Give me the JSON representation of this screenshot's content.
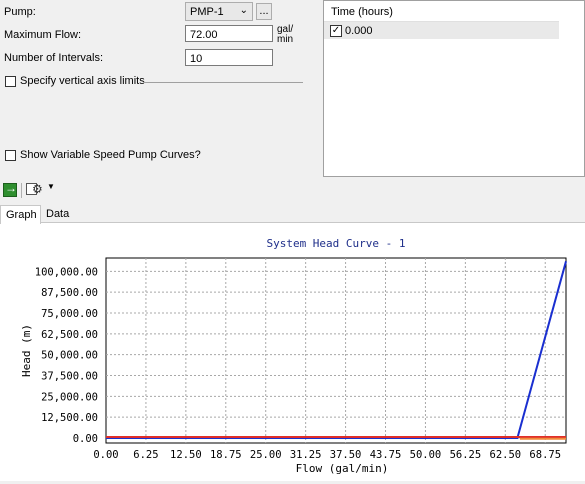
{
  "form": {
    "pump_label": "Pump:",
    "pump_value": "PMP-1",
    "browse_label": "...",
    "max_flow_label": "Maximum Flow:",
    "max_flow_value": "72.00",
    "max_flow_unit": "gal/min",
    "intervals_label": "Number of Intervals:",
    "intervals_value": "10",
    "vertical_limits_label": "Specify vertical axis limits",
    "vertical_limits_checked": false,
    "variable_speed_label": "Show Variable Speed Pump Curves?",
    "variable_speed_checked": false
  },
  "times": {
    "header": "Time (hours)",
    "items": [
      {
        "label": "0.000",
        "checked": true
      }
    ]
  },
  "toolbar": {
    "run_icon": "green-arrow-icon",
    "options_icon": "chart-options-icon"
  },
  "tabs": [
    {
      "label": "Graph",
      "active": true
    },
    {
      "label": "Data",
      "active": false
    }
  ],
  "chart_data": {
    "type": "line",
    "title": "System Head Curve - 1",
    "xlabel": "Flow (gal/min)",
    "ylabel": "Head (m)",
    "xlim": [
      0,
      72
    ],
    "ylim": [
      -3000,
      108000
    ],
    "x_ticks": [
      "0.00",
      "6.25",
      "12.50",
      "18.75",
      "25.00",
      "31.25",
      "37.50",
      "43.75",
      "50.00",
      "56.25",
      "62.50",
      "68.75"
    ],
    "y_ticks": [
      "0.00",
      "12,500.00",
      "25,000.00",
      "37,500.00",
      "50,000.00",
      "62,500.00",
      "75,000.00",
      "87,500.00",
      "100,000.00"
    ],
    "grid": true,
    "series": [
      {
        "color": "#1a2fd0",
        "points": [
          [
            0,
            0
          ],
          [
            64.4,
            0
          ],
          [
            72,
            106000
          ]
        ]
      },
      {
        "color": "#e0302a",
        "points": [
          [
            0,
            600
          ],
          [
            72,
            600
          ]
        ]
      },
      {
        "color": "#f08a3a",
        "points": [
          [
            64.8,
            -500
          ],
          [
            72,
            -500
          ]
        ]
      }
    ]
  }
}
